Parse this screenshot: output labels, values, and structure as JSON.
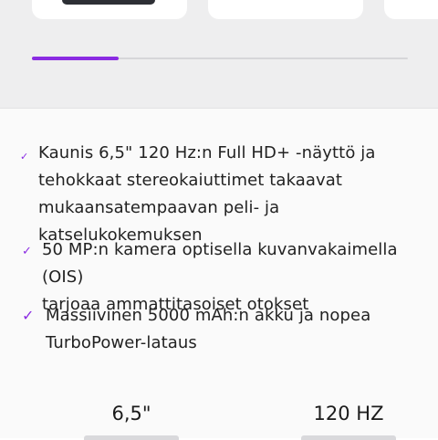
{
  "carousel": {
    "progress_fraction": 0.23,
    "accent_color": "#8a2be2"
  },
  "features": [
    {
      "icon": "check-icon",
      "text": "Kaunis 6,5\" 120 Hz:n Full HD+ -näyttö ja\ntehokkaat stereokaiuttimet takaavat\nmukaansatempaavan peli- ja katselukokemuksen"
    },
    {
      "icon": "check-icon",
      "text": "50 MP:n kamera optisella kuvanvakaimella (OIS)\ntarjoaa ammattitasoiset otokset"
    },
    {
      "icon": "check-icon",
      "text": "Massiivinen 5000 mAh:n akku ja nopea\nTurboPower-lataus"
    }
  ],
  "specs": [
    {
      "value": "6,5\""
    },
    {
      "value": "120 HZ"
    }
  ],
  "colors": {
    "top_background": "#eeeeef",
    "bottom_background": "#fafafa",
    "check": "#8a2be2"
  }
}
